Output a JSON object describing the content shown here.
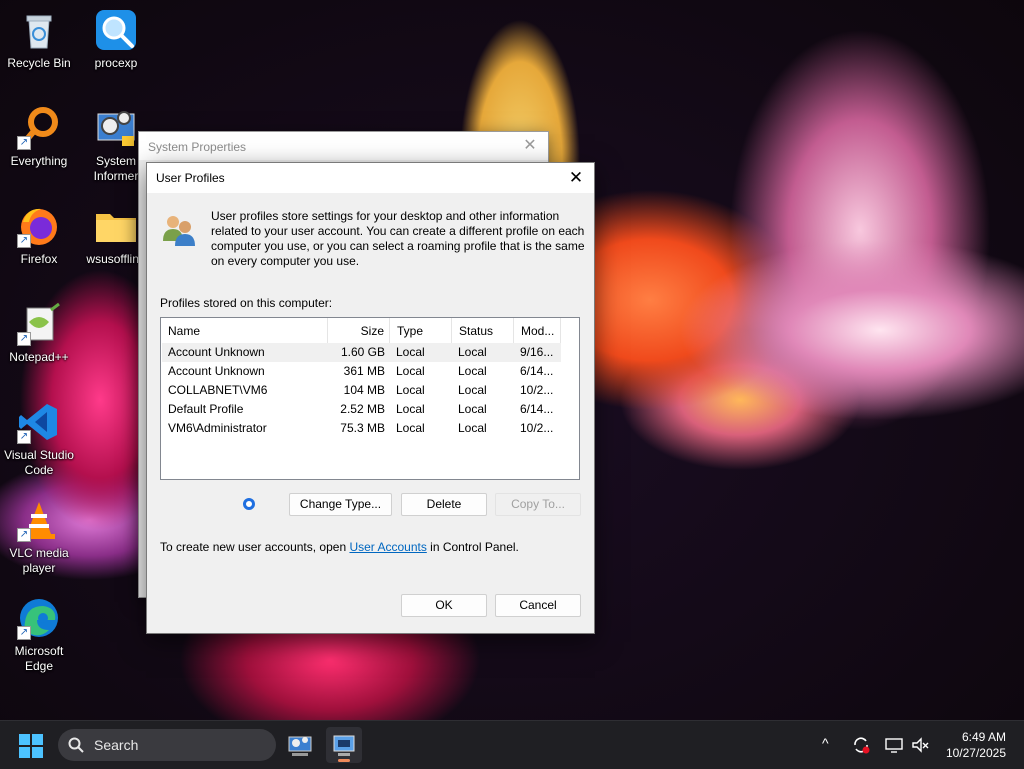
{
  "desktop": {
    "icons": [
      {
        "label": "Recycle Bin"
      },
      {
        "label": "procexp"
      },
      {
        "label": "Everything"
      },
      {
        "label": "System Informer"
      },
      {
        "label": "Firefox"
      },
      {
        "label": "wsusoffline"
      },
      {
        "label": "Notepad++"
      },
      {
        "label": "Visual Studio Code"
      },
      {
        "label": "VLC media player"
      },
      {
        "label": "Microsoft Edge"
      }
    ]
  },
  "system_properties": {
    "title": "System Properties",
    "close_glyph": "✕"
  },
  "user_profiles": {
    "title": "User Profiles",
    "close_glyph": "✕",
    "description": "User profiles store settings for your desktop and other information related to your user account. You can create a different profile on each computer you use, or you can select a roaming profile that is the same on every computer you use.",
    "list_label": "Profiles stored on this computer:",
    "columns": [
      "Name",
      "Size",
      "Type",
      "Status",
      "Mod..."
    ],
    "rows": [
      {
        "name": "Account Unknown",
        "size": "1.60 GB",
        "type": "Local",
        "status": "Local",
        "modified": "9/16..."
      },
      {
        "name": "Account Unknown",
        "size": "361 MB",
        "type": "Local",
        "status": "Local",
        "modified": "6/14..."
      },
      {
        "name": "COLLABNET\\VM6",
        "size": "104 MB",
        "type": "Local",
        "status": "Local",
        "modified": "10/2..."
      },
      {
        "name": "Default Profile",
        "size": "2.52 MB",
        "type": "Local",
        "status": "Local",
        "modified": "6/14..."
      },
      {
        "name": "VM6\\Administrator",
        "size": "75.3 MB",
        "type": "Local",
        "status": "Local",
        "modified": "10/2..."
      }
    ],
    "buttons": {
      "change_type": "Change Type...",
      "delete": "Delete",
      "copy_to": "Copy To..."
    },
    "footer_before": "To create new user accounts, open ",
    "footer_link": "User Accounts",
    "footer_after": " in Control Panel.",
    "ok": "OK",
    "cancel": "Cancel"
  },
  "taskbar": {
    "search_label": "Search",
    "time": "6:49 AM",
    "date": "10/27/2025",
    "tray_chevron": "^"
  },
  "colors": {
    "accent": "#0067c0",
    "taskbar": "#1f1f23"
  }
}
